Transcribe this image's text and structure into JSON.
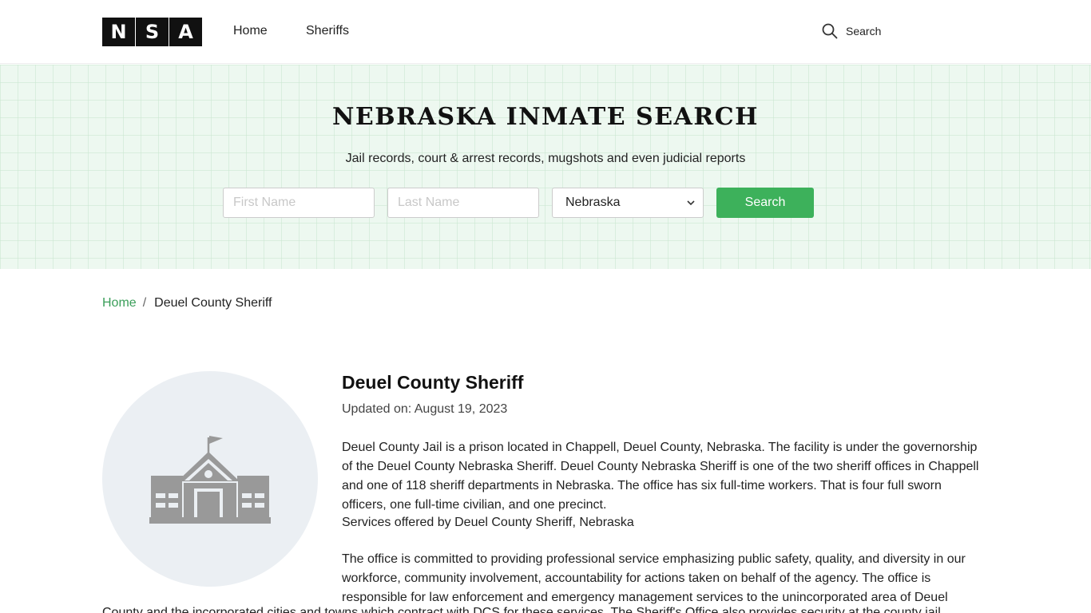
{
  "header": {
    "logo_letters": [
      "N",
      "S",
      "A"
    ],
    "nav": [
      {
        "label": "Home"
      },
      {
        "label": "Sheriffs"
      }
    ],
    "search_label": "Search"
  },
  "hero": {
    "title": "NEBRASKA INMATE SEARCH",
    "subtitle": "Jail records, court & arrest records, mugshots and even judicial reports",
    "first_name_placeholder": "First Name",
    "last_name_placeholder": "Last Name",
    "state_selected": "Nebraska",
    "search_button": "Search",
    "button_color": "#3db15b"
  },
  "breadcrumb": {
    "home": "Home",
    "separator": "/",
    "current": "Deuel County Sheriff"
  },
  "main": {
    "icon": "courthouse-icon",
    "title": "Deuel County Sheriff",
    "updated": "Updated on: August 19, 2023",
    "paragraph1": "Deuel County Jail is a prison located in Chappell, Deuel County, Nebraska. The facility is under the governorship of the Deuel County Nebraska Sheriff.  Deuel County Nebraska Sheriff is one of the two sheriff offices in Chappell and one of 118 sheriff departments in Nebraska. The office has six full-time workers. That is four full sworn officers, one full-time civilian, and one precinct.",
    "paragraph2": "Services offered by Deuel County Sheriff, Nebraska",
    "paragraph3": "The office is committed to providing professional service emphasizing public safety, quality, and diversity in our workforce, community involvement, accountability for actions taken on behalf of the agency.  The office is responsible for law enforcement and emergency management services to the unincorporated area of Deuel",
    "paragraph3_continued": "County and the incorporated cities and towns which contract with DCS for these services. The Sheriff's Office also provides security at the county jail"
  }
}
